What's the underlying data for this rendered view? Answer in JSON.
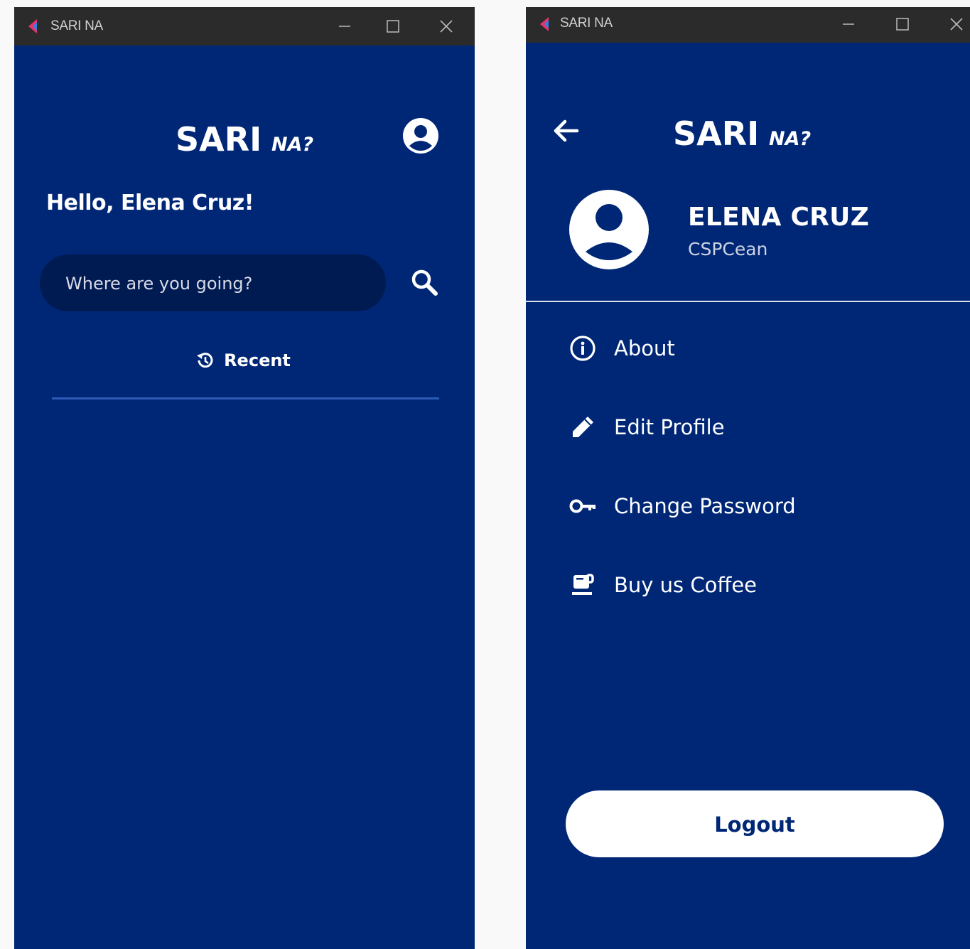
{
  "app": {
    "window_title": "SARI NA",
    "brand_main": "SARI",
    "brand_suffix": "NA?"
  },
  "home": {
    "greeting": "Hello, Elena Cruz!",
    "search": {
      "placeholder": "Where are you going?",
      "value": ""
    },
    "recent_label": "Recent"
  },
  "profile": {
    "name": "ELENA CRUZ",
    "subtitle": "CSPCean",
    "menu": [
      {
        "label": "About",
        "icon": "info-icon"
      },
      {
        "label": "Edit Profile",
        "icon": "pencil-icon"
      },
      {
        "label": "Change Password",
        "icon": "key-icon"
      },
      {
        "label": "Buy us Coffee",
        "icon": "coffee-icon"
      }
    ],
    "logout_label": "Logout"
  },
  "colors": {
    "primary": "#002776",
    "search_bg": "#001a52",
    "titlebar": "#2b2b2b",
    "logo_accent": "#e8336b"
  }
}
